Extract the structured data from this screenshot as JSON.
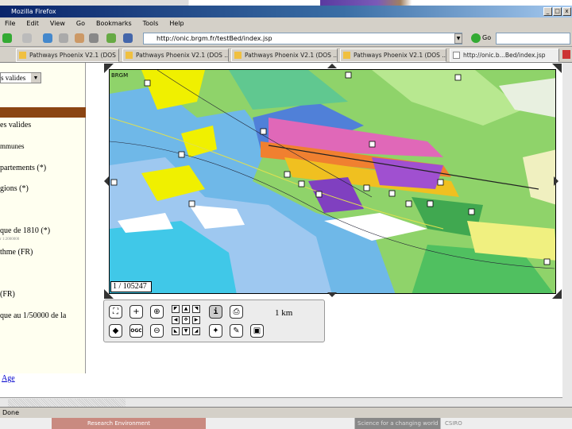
{
  "window": {
    "title": "Mozilla Firefox",
    "buttons": [
      "_",
      "□",
      "x"
    ]
  },
  "menu": [
    "File",
    "Edit",
    "View",
    "Go",
    "Bookmarks",
    "Tools",
    "Help"
  ],
  "nav": {
    "url": "http://onic.brgm.fr/testBed/index.jsp",
    "go_label": "Go"
  },
  "tabs": [
    "Pathways Phoenix V2.1 (DOS ...",
    "Pathways Phoenix V2.1 (DOS ...",
    "Pathways Phoenix V2.1 (DOS ...",
    "Pathways Phoenix V2.1 (DOS ...",
    "http://onic.b...Bed/index.jsp"
  ],
  "left_panel": {
    "select_value": "s valides",
    "items": [
      "es valides",
      "mmunes",
      "partements (*)",
      "gions (*)",
      "que de 1810 (*)",
      "r 1:2000000",
      "thme (FR)",
      "(FR)",
      "que au 1/50000 de la"
    ],
    "link": "Age"
  },
  "map": {
    "logo": "BRGM",
    "scale": "1 / 105247"
  },
  "toolbar": {
    "scale_bar": "1 km",
    "ogc_label": "OGC"
  },
  "status": {
    "text": "Done"
  },
  "bottom": {
    "text1": "Research Environment",
    "text2": "Science for a changing world",
    "text3": "CSIRO"
  }
}
